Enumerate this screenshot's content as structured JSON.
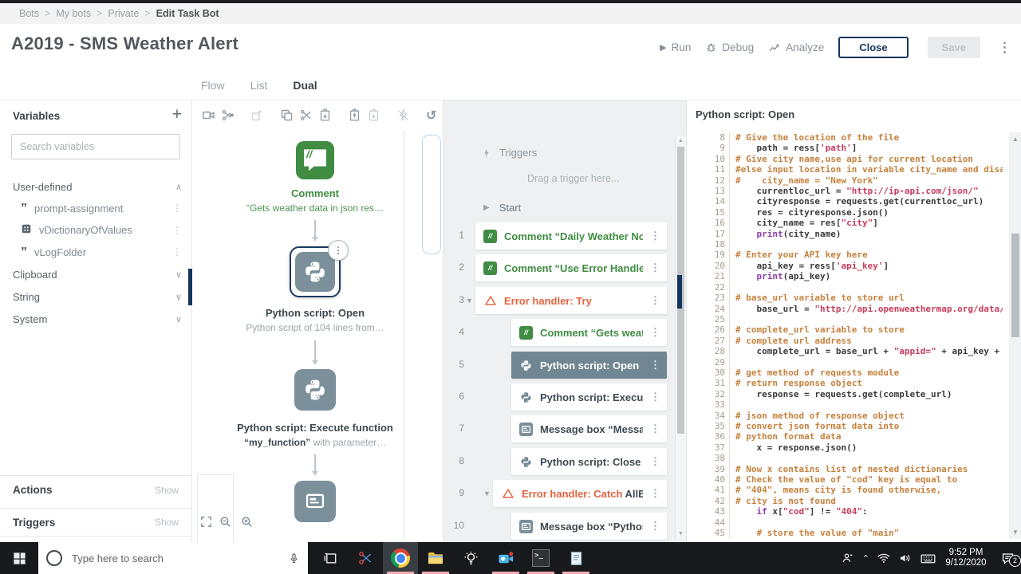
{
  "window": {
    "breadcrumb": [
      "Bots",
      "My bots",
      "Private",
      "Edit Task Bot"
    ],
    "title": "A2019 - SMS Weather Alert",
    "actions": {
      "run": "Run",
      "debug": "Debug",
      "analyze": "Analyze",
      "close": "Close",
      "save": "Save"
    },
    "tabs": [
      {
        "label": "Flow",
        "active": false
      },
      {
        "label": "List",
        "active": false
      },
      {
        "label": "Dual",
        "active": true
      }
    ]
  },
  "variables": {
    "title": "Variables",
    "search_placeholder": "Search variables",
    "sections": [
      {
        "label": "User-defined",
        "expanded": true,
        "items": [
          {
            "icon": "string",
            "name": "prompt-assignment"
          },
          {
            "icon": "dict",
            "name": "vDictionaryOfValues"
          },
          {
            "icon": "string",
            "name": "vLogFolder"
          }
        ]
      },
      {
        "label": "Clipboard",
        "expanded": false,
        "items": []
      },
      {
        "label": "String",
        "expanded": false,
        "items": []
      },
      {
        "label": "System",
        "expanded": false,
        "items": []
      }
    ],
    "footer": [
      {
        "label": "Actions",
        "action": "Show"
      },
      {
        "label": "Triggers",
        "action": "Show"
      }
    ]
  },
  "flow": {
    "toolbar": [
      {
        "icon": "camera"
      },
      {
        "icon": "trim"
      },
      {
        "sep": true
      },
      {
        "icon": "magic",
        "disabled": true
      },
      {
        "sep": true
      },
      {
        "icon": "copy"
      },
      {
        "icon": "cut"
      },
      {
        "icon": "paste"
      },
      {
        "sep": true
      },
      {
        "icon": "clipup"
      },
      {
        "icon": "clipdown",
        "disabled": true
      },
      {
        "sep": true
      },
      {
        "icon": "norun",
        "disabled": true
      },
      {
        "sep": true
      },
      {
        "icon": "undo"
      },
      {
        "icon": "redo",
        "disabled": true
      }
    ],
    "nodes": [
      {
        "kind": "comment",
        "title": "Comment",
        "subtitle": "“Gets weather data in json res…"
      },
      {
        "kind": "python",
        "title": "Python script: Open",
        "subtitle": "Python script of 104 lines from…",
        "selected": true
      },
      {
        "kind": "python",
        "title": "Python script: Execute function",
        "sub_bold": "“my_function”",
        "sub_rest": " with parameter…"
      },
      {
        "kind": "messagebox"
      }
    ]
  },
  "list": {
    "triggers_label": "Triggers",
    "trigger_placeholder": "Drag a trigger here...",
    "start_label": "Start",
    "rows": [
      {
        "n": "1",
        "indent": 0,
        "icon": "comment",
        "text": [
          [
            "Comment “Daily Weather No",
            "green"
          ],
          [
            "…",
            "dim"
          ]
        ]
      },
      {
        "n": "2",
        "indent": 0,
        "icon": "comment",
        "text": [
          [
            "Comment “Use Error Handler",
            "green"
          ],
          [
            "…",
            "dim"
          ]
        ]
      },
      {
        "n": "3",
        "indent": 0,
        "icon": "error",
        "caret": true,
        "text": [
          [
            "Error handler: Try",
            "orange"
          ]
        ]
      },
      {
        "n": "4",
        "indent": 2,
        "icon": "comment",
        "text": [
          [
            "Comment “Gets weat",
            "green"
          ],
          [
            "…",
            "dim"
          ]
        ]
      },
      {
        "n": "5",
        "indent": 2,
        "icon": "python",
        "selected": true,
        "text": [
          [
            "Python script: Open ",
            "white"
          ],
          [
            "…",
            "wdim"
          ]
        ]
      },
      {
        "n": "6",
        "indent": 2,
        "icon": "python",
        "text": [
          [
            "Python script: Execut",
            "dark"
          ],
          [
            "…",
            "dim"
          ]
        ]
      },
      {
        "n": "7",
        "indent": 2,
        "icon": "msgbox",
        "text": [
          [
            "Message box “Messag",
            "dark"
          ],
          [
            "…",
            "dim"
          ]
        ]
      },
      {
        "n": "8",
        "indent": 2,
        "icon": "python",
        "text": [
          [
            "Python script: Close ",
            "dark"
          ],
          [
            "…",
            "dim"
          ]
        ]
      },
      {
        "n": "9",
        "indent": 1,
        "icon": "error",
        "caret": true,
        "text": [
          [
            "Error handler: Catch ",
            "orange"
          ],
          [
            "AllEr",
            "dark"
          ],
          [
            "…",
            "dim"
          ]
        ]
      },
      {
        "n": "10",
        "indent": 2,
        "icon": "msgbox",
        "text": [
          [
            "Message box “Python",
            "dark"
          ],
          [
            "…",
            "dim"
          ]
        ]
      }
    ]
  },
  "code": {
    "header": "Python script: Open",
    "lines": [
      [
        8,
        [
          [
            "# Give the location of the file",
            "c"
          ]
        ]
      ],
      [
        9,
        [
          [
            "    path = ress[",
            "d"
          ],
          [
            "'path'",
            "s"
          ],
          [
            "]",
            "d"
          ]
        ]
      ],
      [
        10,
        [
          [
            "# Give city name,use api for current location",
            "c"
          ]
        ]
      ],
      [
        11,
        [
          [
            "#else input location in variable city_name and disa",
            "c"
          ]
        ]
      ],
      [
        12,
        [
          [
            "#    city_name = \"New York\"",
            "c"
          ]
        ]
      ],
      [
        13,
        [
          [
            "    currentloc_url = ",
            "d"
          ],
          [
            "\"http://ip-api.com/json/\"",
            "s"
          ]
        ]
      ],
      [
        14,
        [
          [
            "    cityresponse = requests.get(currentloc_url)",
            "d"
          ]
        ]
      ],
      [
        15,
        [
          [
            "    res = cityresponse.json()",
            "d"
          ]
        ]
      ],
      [
        16,
        [
          [
            "    city_name = res[",
            "d"
          ],
          [
            "\"city\"",
            "s"
          ],
          [
            "]",
            "d"
          ]
        ]
      ],
      [
        17,
        [
          [
            "    ",
            "d"
          ],
          [
            "print",
            "k"
          ],
          [
            "(city_name)",
            "d"
          ]
        ]
      ],
      [
        18,
        []
      ],
      [
        19,
        [
          [
            "# Enter your API key here",
            "c"
          ]
        ]
      ],
      [
        20,
        [
          [
            "    api_key = ress[",
            "d"
          ],
          [
            "'api_key'",
            "s"
          ],
          [
            "]",
            "d"
          ]
        ]
      ],
      [
        21,
        [
          [
            "    ",
            "d"
          ],
          [
            "print",
            "k"
          ],
          [
            "(api_key)",
            "d"
          ]
        ]
      ],
      [
        22,
        []
      ],
      [
        23,
        [
          [
            "# base_url variable to store url",
            "c"
          ]
        ]
      ],
      [
        24,
        [
          [
            "    base_url = ",
            "d"
          ],
          [
            "\"http://api.openweathermap.org/data/",
            "s"
          ]
        ]
      ],
      [
        25,
        []
      ],
      [
        26,
        [
          [
            "# complete_url variable to store",
            "c"
          ]
        ]
      ],
      [
        27,
        [
          [
            "# complete url address",
            "c"
          ]
        ]
      ],
      [
        28,
        [
          [
            "    complete_url = base_url + ",
            "d"
          ],
          [
            "\"appid=\"",
            "s"
          ],
          [
            " + api_key +",
            "d"
          ]
        ]
      ],
      [
        29,
        []
      ],
      [
        30,
        [
          [
            "# get method of requests module",
            "c"
          ]
        ]
      ],
      [
        31,
        [
          [
            "# return response object",
            "c"
          ]
        ]
      ],
      [
        32,
        [
          [
            "    response = requests.get(complete_url)",
            "d"
          ]
        ]
      ],
      [
        33,
        []
      ],
      [
        34,
        [
          [
            "# json method of response object",
            "c"
          ]
        ]
      ],
      [
        35,
        [
          [
            "# convert json format data into",
            "c"
          ]
        ]
      ],
      [
        36,
        [
          [
            "# python format data",
            "c"
          ]
        ]
      ],
      [
        37,
        [
          [
            "    x = response.json()",
            "d"
          ]
        ]
      ],
      [
        38,
        []
      ],
      [
        39,
        [
          [
            "# Now x contains list of nested dictionaries",
            "c"
          ]
        ]
      ],
      [
        40,
        [
          [
            "# Check the value of \"cod\" key is equal to",
            "c"
          ]
        ]
      ],
      [
        41,
        [
          [
            "# \"404\", means city is found otherwise,",
            "c"
          ]
        ]
      ],
      [
        42,
        [
          [
            "# city is not found",
            "c"
          ]
        ]
      ],
      [
        43,
        [
          [
            "    ",
            "d"
          ],
          [
            "if",
            "k"
          ],
          [
            " x[",
            "d"
          ],
          [
            "\"cod\"",
            "s"
          ],
          [
            "] != ",
            "d"
          ],
          [
            "\"404\"",
            "s"
          ],
          [
            ":",
            "d"
          ]
        ]
      ],
      [
        44,
        []
      ],
      [
        45,
        [
          [
            "    # store the value of \"main\"",
            "c"
          ]
        ]
      ]
    ]
  },
  "taskbar": {
    "search_placeholder": "Type here to search",
    "time": "9:52 PM",
    "date": "9/12/2020",
    "notification_count": "2"
  },
  "colors": {
    "accent": "#16355c",
    "green": "#3f8c42",
    "orange": "#e4633f",
    "slate": "#7b909b"
  }
}
